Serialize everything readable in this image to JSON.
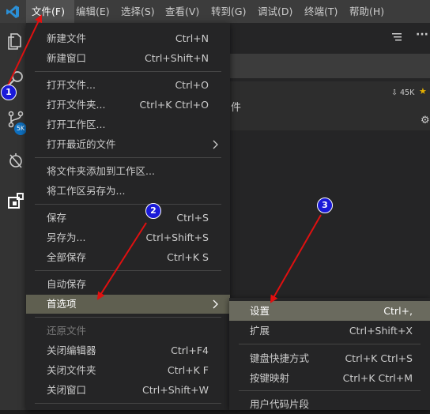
{
  "menubar": {
    "items": [
      {
        "label": "文件(F)"
      },
      {
        "label": "编辑(E)"
      },
      {
        "label": "选择(S)"
      },
      {
        "label": "查看(V)"
      },
      {
        "label": "转到(G)"
      },
      {
        "label": "调试(D)"
      },
      {
        "label": "终端(T)"
      },
      {
        "label": "帮助(H)"
      }
    ]
  },
  "activity": {
    "badge": "5K"
  },
  "right_panel": {
    "downloads": "45K",
    "partial_text": "件"
  },
  "file_menu": {
    "items": [
      {
        "label": "新建文件",
        "shortcut": "Ctrl+N"
      },
      {
        "label": "新建窗口",
        "shortcut": "Ctrl+Shift+N"
      },
      {
        "label": "打开文件...",
        "shortcut": "Ctrl+O"
      },
      {
        "label": "打开文件夹...",
        "shortcut": "Ctrl+K Ctrl+O"
      },
      {
        "label": "打开工作区...",
        "shortcut": ""
      },
      {
        "label": "打开最近的文件",
        "shortcut": ""
      },
      {
        "label": "将文件夹添加到工作区...",
        "shortcut": ""
      },
      {
        "label": "将工作区另存为...",
        "shortcut": ""
      },
      {
        "label": "保存",
        "shortcut": "Ctrl+S"
      },
      {
        "label": "另存为...",
        "shortcut": "Ctrl+Shift+S"
      },
      {
        "label": "全部保存",
        "shortcut": "Ctrl+K S"
      },
      {
        "label": "自动保存",
        "shortcut": ""
      },
      {
        "label": "首选项",
        "shortcut": ""
      },
      {
        "label": "还原文件",
        "shortcut": ""
      },
      {
        "label": "关闭编辑器",
        "shortcut": "Ctrl+F4"
      },
      {
        "label": "关闭文件夹",
        "shortcut": "Ctrl+K F"
      },
      {
        "label": "关闭窗口",
        "shortcut": "Ctrl+Shift+W"
      }
    ]
  },
  "preferences_submenu": {
    "items": [
      {
        "label": "设置",
        "shortcut": "Ctrl+,"
      },
      {
        "label": "扩展",
        "shortcut": "Ctrl+Shift+X"
      },
      {
        "label": "键盘快捷方式",
        "shortcut": "Ctrl+K Ctrl+S"
      },
      {
        "label": "按键映射",
        "shortcut": "Ctrl+K Ctrl+M"
      },
      {
        "label": "用户代码片段",
        "shortcut": ""
      }
    ]
  },
  "annotations": {
    "step1": "1",
    "step2": "2",
    "step3": "3"
  },
  "colors": {
    "menubar_bg": "#3c3c3c",
    "menu_bg": "#252526",
    "selected_bg": "#5f5f50",
    "arrow_red": "#e01010",
    "badge_blue": "#1a1ad8"
  }
}
